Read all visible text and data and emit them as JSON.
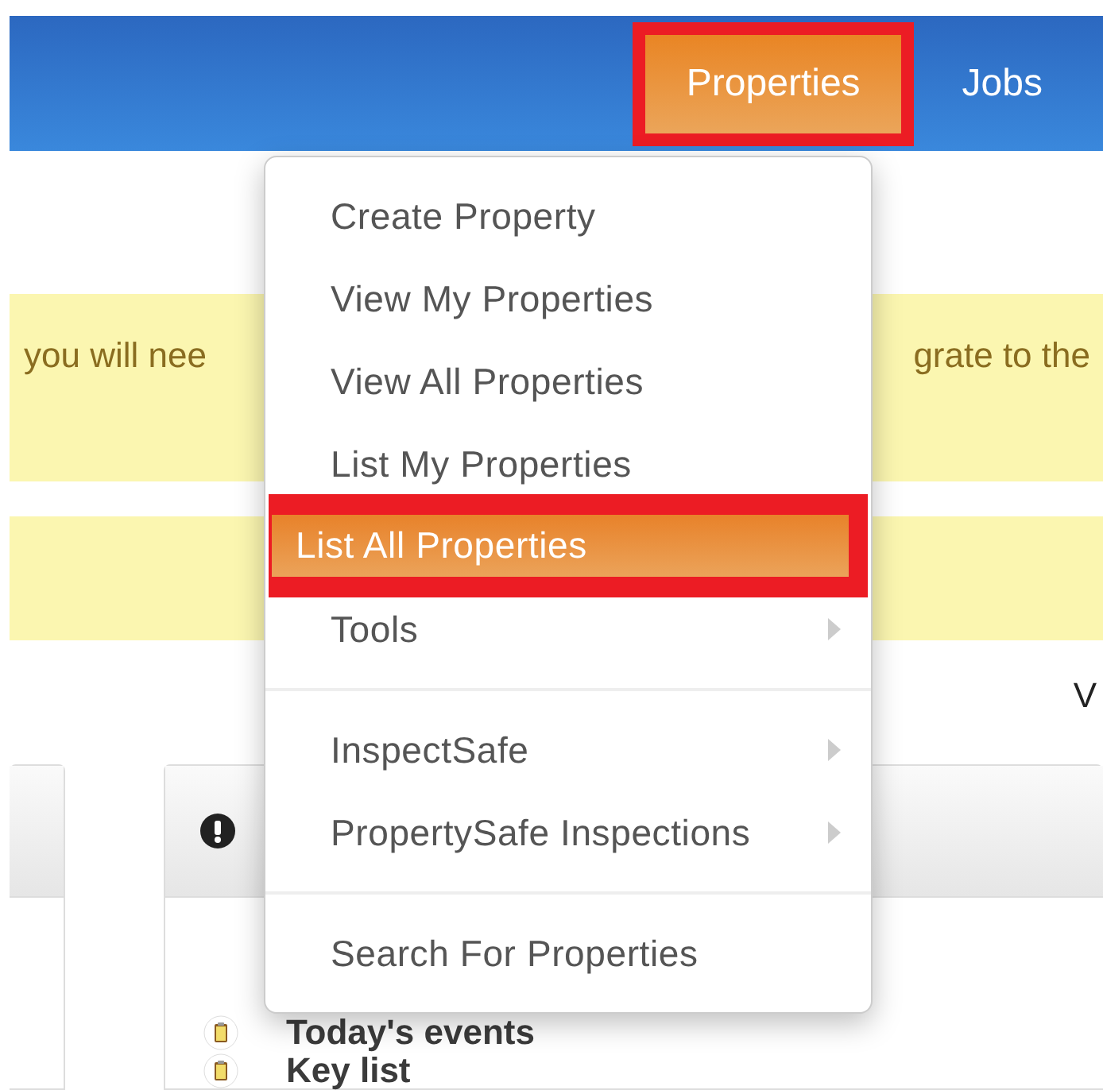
{
  "nav": {
    "tabs": [
      {
        "label": "Properties",
        "selected": true,
        "outlined": true
      },
      {
        "label": "Jobs",
        "selected": false,
        "outlined": false
      }
    ]
  },
  "banners": [
    {
      "kind": "notice",
      "texts": [
        "you will nee",
        "grate to the"
      ]
    },
    {
      "kind": "notice"
    }
  ],
  "right_edge_text": "V",
  "panel": {
    "rows": [
      {
        "title": "Today's events"
      },
      {
        "title": "Key list"
      }
    ]
  },
  "menu": {
    "items": [
      {
        "kind": "item",
        "label": "Create Property",
        "selected": false,
        "outlined": false,
        "submenu": false
      },
      {
        "kind": "item",
        "label": "View My Properties",
        "selected": false,
        "outlined": false,
        "submenu": false
      },
      {
        "kind": "item",
        "label": "View All Properties",
        "selected": false,
        "outlined": false,
        "submenu": false
      },
      {
        "kind": "item",
        "label": "List My Properties",
        "selected": false,
        "outlined": false,
        "submenu": false
      },
      {
        "kind": "item",
        "label": "List All Properties",
        "selected": true,
        "outlined": true,
        "submenu": false
      },
      {
        "kind": "item",
        "label": "Tools",
        "selected": false,
        "outlined": false,
        "submenu": true
      },
      {
        "kind": "separator"
      },
      {
        "kind": "item",
        "label": "InspectSafe",
        "selected": false,
        "outlined": false,
        "submenu": true
      },
      {
        "kind": "item",
        "label": "PropertySafe Inspections",
        "selected": false,
        "outlined": false,
        "submenu": true
      },
      {
        "kind": "separator"
      },
      {
        "kind": "item",
        "label": "Search For Properties",
        "selected": false,
        "outlined": false,
        "submenu": false
      }
    ]
  }
}
